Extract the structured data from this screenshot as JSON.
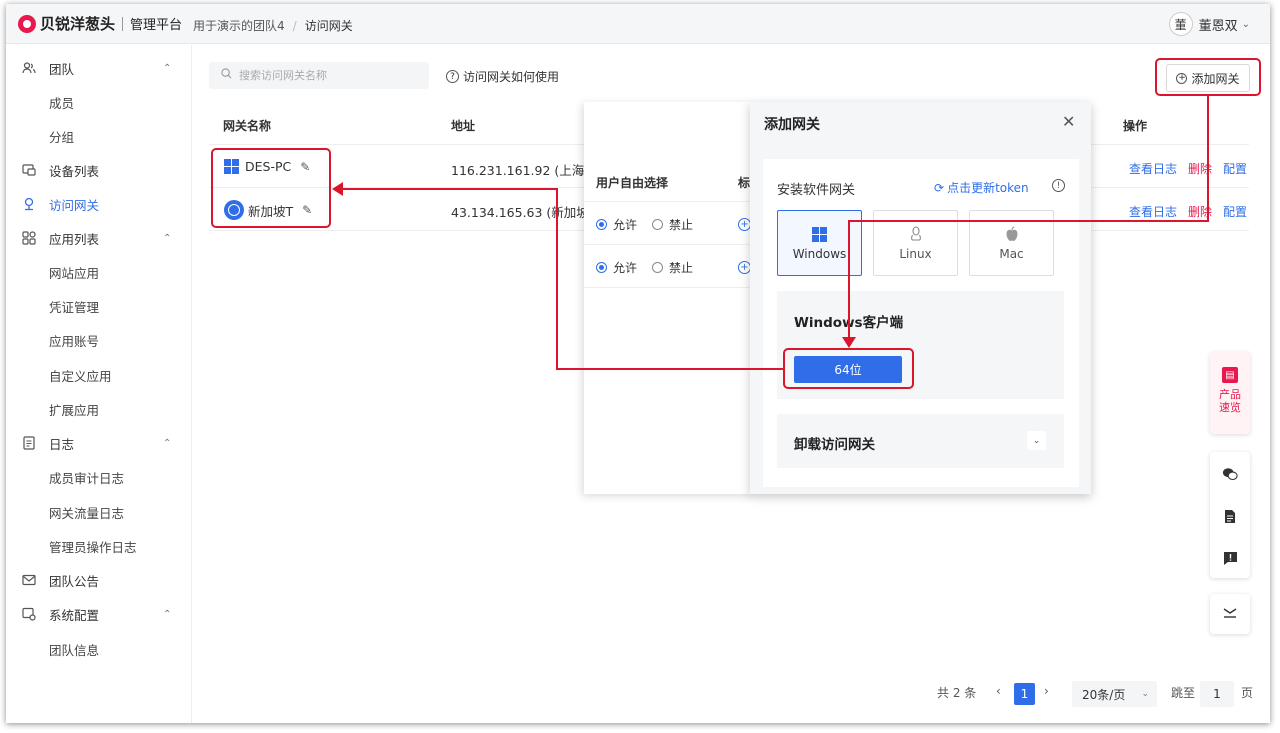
{
  "header": {
    "brand": "贝锐洋葱头",
    "platform": "管理平台",
    "breadcrumb": [
      "用于演示的团队4",
      "访问网关"
    ],
    "user_avatar": "董",
    "user_name": "董恩双"
  },
  "sidebar": {
    "items": [
      {
        "label": "团队",
        "icon": "team-icon",
        "expanded": true
      },
      {
        "label": "成员"
      },
      {
        "label": "分组"
      },
      {
        "label": "设备列表",
        "icon": "device-icon"
      },
      {
        "label": "访问网关",
        "icon": "gateway-icon",
        "active": true
      },
      {
        "label": "应用列表",
        "icon": "apps-icon",
        "expanded": true
      },
      {
        "label": "网站应用"
      },
      {
        "label": "凭证管理"
      },
      {
        "label": "应用账号"
      },
      {
        "label": "自定义应用"
      },
      {
        "label": "扩展应用"
      },
      {
        "label": "日志",
        "icon": "log-icon",
        "expanded": true
      },
      {
        "label": "成员审计日志"
      },
      {
        "label": "网关流量日志"
      },
      {
        "label": "管理员操作日志"
      },
      {
        "label": "团队公告",
        "icon": "mail-icon"
      },
      {
        "label": "系统配置",
        "icon": "settings-icon",
        "expanded": true
      },
      {
        "label": "团队信息"
      }
    ]
  },
  "toolbar": {
    "search_placeholder": "搜索访问网关名称",
    "howto_label": "访问网关如何使用",
    "add_label": "添加网关"
  },
  "table": {
    "headers": {
      "name": "网关名称",
      "address": "地址",
      "ops": "操作"
    },
    "rows": [
      {
        "name": "DES-PC",
        "os": "windows",
        "address": "116.231.161.92 (上海市"
      },
      {
        "name": "新加坡T",
        "os": "ubuntu",
        "address": "43.134.165.63 (新加坡"
      }
    ],
    "ops": {
      "log": "查看日志",
      "delete": "删除",
      "config": "配置"
    }
  },
  "midpanel": {
    "col1_header": "用户自由选择",
    "col2_header": "标",
    "allow_label": "允许",
    "deny_label": "禁止",
    "rows": [
      {
        "allow": true
      },
      {
        "allow": true
      }
    ]
  },
  "modal": {
    "title": "添加网关",
    "install_title": "安装软件网关",
    "refresh_label": "点击更新token",
    "os_options": [
      "Windows",
      "Linux",
      "Mac"
    ],
    "selected_os": "Windows",
    "client_title": "Windows客户端",
    "download_label": "64位",
    "uninstall_title": "卸载访问网关"
  },
  "float": {
    "product_label": "产品速览"
  },
  "pagination": {
    "total": "共 2 条",
    "current_page": "1",
    "page_size": "20条/页",
    "jump_label": "跳至",
    "jump_value": "1",
    "page_suffix": "页"
  },
  "colors": {
    "accent": "#2f6ee8",
    "brand": "#e8194f",
    "annotation": "#d9162b"
  }
}
